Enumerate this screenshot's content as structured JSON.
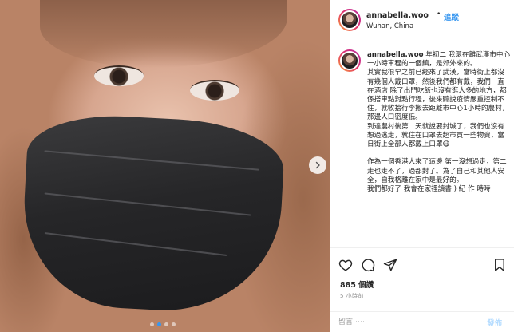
{
  "post": {
    "username": "annabella.woo",
    "follow_separator": "•",
    "follow_label": "追蹤",
    "location": "Wuhan, China",
    "caption_username": "annabella.woo",
    "caption_body": " 年初二 我還在離武漢市中心一小時車程的一個鎮，是郊外來的。\n其實我很早之前已經來了武漢，當時街上都沒有幾個人戴口罩，然後我們都有戴，我們一直在酒店 除了出門吃飯也沒有逛人多的地方，都係搭車點對點行程，後來聽說疫情嚴重控制不住，就收拾行李搬去距離市中心1小時的農村，那邊人口密度低。\n到達農村後第二天就說要封城了，我們也沒有想過逃走，就住在口罩去超市買一些物資，當日街上全部人都戴上口罩😷\n\n作為一個香港人來了這邊 第一沒想過走，第二走也走不了，過都封了。為了自己和其他人安全，自我格離在家中是最好的。\n我們都好了 我會在家裡讀書 ) 紀 作 時時",
    "likes": "885 個讚",
    "time_ago": "5 小時前",
    "comment_placeholder": "留言⋯⋯",
    "post_label": "發佈",
    "carousel": {
      "total": 4,
      "active": 1
    }
  },
  "icons": {
    "like": "heart-icon",
    "comment": "comment-icon",
    "share": "share-icon",
    "save": "bookmark-icon",
    "next": "chevron-right-icon"
  },
  "colors": {
    "link": "#3897f0",
    "text": "#262626",
    "muted": "#8e8e8e",
    "post_disabled": "#b3dbff"
  }
}
